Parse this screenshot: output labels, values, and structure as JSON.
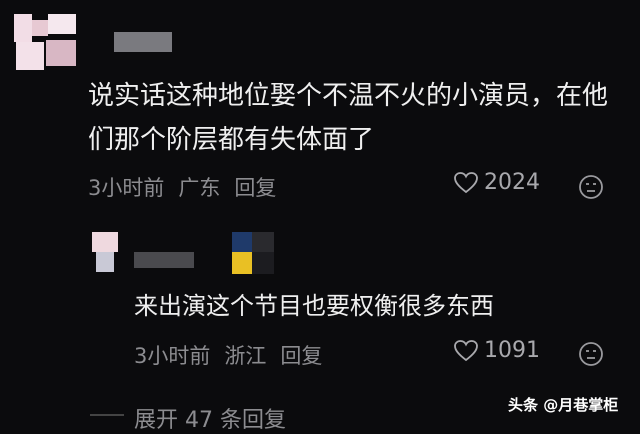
{
  "comment1": {
    "content": "说实话这种地位娶个不温不火的小演员，在他们那个阶层都有失体面了",
    "time": "3小时前",
    "location": "广东",
    "reply_label": "回复",
    "likes": "2024"
  },
  "reply1": {
    "content": "来出演这个节目也要权衡很多东西",
    "time": "3小时前",
    "location": "浙江",
    "reply_label": "回复",
    "likes": "1091"
  },
  "expand": {
    "label": "展开 47 条回复"
  },
  "watermark": {
    "text": "头条 @月巷掌柜"
  },
  "icons": {
    "like": "heart-icon",
    "more": "emoji-icon"
  }
}
